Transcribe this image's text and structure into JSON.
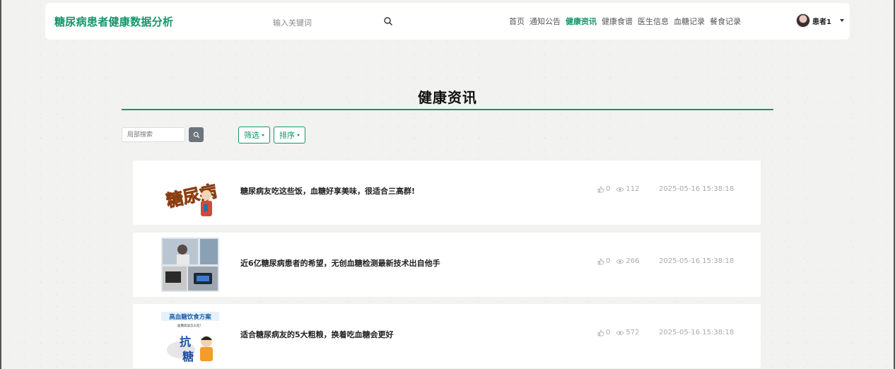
{
  "header": {
    "brand": "糖尿病患者健康数据分析",
    "search_placeholder": "输入关键词",
    "nav": [
      "首页",
      "通知公告",
      "健康资讯",
      "健康食谱",
      "医生信息",
      "血糖记录",
      "餐食记录"
    ],
    "active_nav": "健康资讯",
    "user_name": "患者1"
  },
  "page": {
    "title": "健康资讯",
    "local_search_placeholder": "局部搜索",
    "filter_label": "筛选",
    "sort_label": "排序"
  },
  "articles": [
    {
      "title": "糖尿病友吃这些⁠饭，血糖好享美味，很适合三高群!",
      "likes": "0",
      "views": "112",
      "date": "2025-05-16 15:38:18",
      "thumb_text": "糖尿病"
    },
    {
      "title": "近6亿糖尿病患者的希望，无创血糖检测最新技术出自他手",
      "likes": "0",
      "views": "266",
      "date": "2025-05-16 15:38:18"
    },
    {
      "title": "适合糖尿病友的5大粗粮，换着吃血糖会更好",
      "likes": "0",
      "views": "572",
      "date": "2025-05-16 15:38:18",
      "thumb_text_top": "高血糖饮食方案",
      "thumb_text_sub": "血糖高该怎么吃！",
      "thumb_text_big1": "抗",
      "thumb_text_big2": "糖"
    }
  ],
  "colors": {
    "accent": "#15966b",
    "card_bg": "#ffffff",
    "muted": "#aaaaaa"
  }
}
